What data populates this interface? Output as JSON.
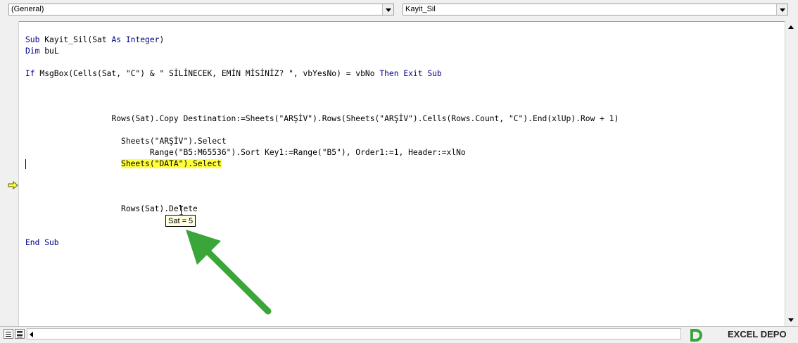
{
  "object_dropdown": {
    "value": "(General)"
  },
  "procedure_dropdown": {
    "value": "Kayit_Sil"
  },
  "code_lines": [
    {
      "parts": [
        {
          "t": "Sub ",
          "k": true
        },
        {
          "t": "Kayit_Sil(Sat "
        },
        {
          "t": "As Integer",
          "k": true
        },
        {
          "t": ")"
        }
      ]
    },
    {
      "parts": [
        {
          "t": "Dim ",
          "k": true
        },
        {
          "t": "buL"
        }
      ]
    },
    {
      "parts": []
    },
    {
      "parts": [
        {
          "t": "If ",
          "k": true
        },
        {
          "t": "MsgBox(Cells(Sat, \"C\") & \" SİLİNECEK, EMİN MİSİNİZ? \", vbYesNo) = vbNo "
        },
        {
          "t": "Then Exit Sub",
          "k": true
        }
      ]
    },
    {
      "parts": []
    },
    {
      "parts": []
    },
    {
      "parts": []
    },
    {
      "indent": "                  ",
      "parts": [
        {
          "t": "Rows(Sat).Copy Destination:=Sheets(\"ARŞİV\").Rows(Sheets(\"ARŞİV\").Cells(Rows.Count, \"C\").End(xlUp).Row + 1)"
        }
      ]
    },
    {
      "parts": []
    },
    {
      "indent": "                    ",
      "parts": [
        {
          "t": "Sheets(\"ARŞİV\").Select"
        }
      ]
    },
    {
      "indent": "                          ",
      "parts": [
        {
          "t": "Range(\"B5:M65536\").Sort Key1:=Range(\"B5\"), Order1:=1, Header:=xlNo"
        }
      ]
    },
    {
      "indent": "                    ",
      "parts": [
        {
          "t": "Sheets(\"DATA\").Select",
          "h": true
        }
      ]
    },
    {
      "parts": []
    },
    {
      "parts": []
    },
    {
      "parts": []
    },
    {
      "indent": "                    ",
      "parts": [
        {
          "t": "Rows(Sat).Delete"
        }
      ]
    },
    {
      "parts": []
    },
    {
      "parts": []
    },
    {
      "parts": [
        {
          "t": "End Sub",
          "k": true
        }
      ]
    }
  ],
  "tooltip": {
    "text": "Sat = 5"
  },
  "colors": {
    "keyword": "#00008b",
    "highlight": "#ffff3c",
    "arrow": "#3aa63a"
  },
  "watermark": {
    "text": "EXCEL DEPO"
  }
}
